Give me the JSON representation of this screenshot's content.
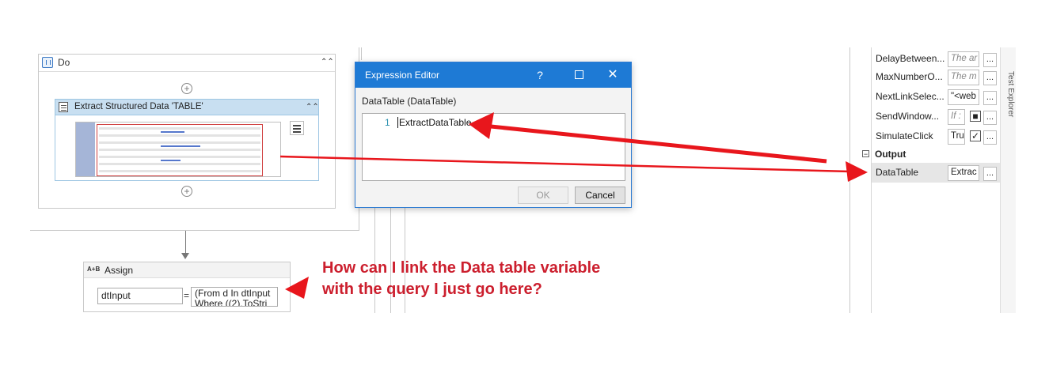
{
  "designer": {
    "do_label": "Do",
    "extract_title": "Extract Structured Data 'TABLE'",
    "assign": {
      "label": "Assign",
      "icon_text": "A+B",
      "to_value": "dtInput",
      "equals": "=",
      "value_text": "(From d In dtInput\nWhere ((2).ToStri"
    }
  },
  "dialog": {
    "title": "Expression Editor",
    "help": "?",
    "close": "✕",
    "type_label": "DataTable (DataTable)",
    "line_number": "1",
    "code": "ExtractDataTable",
    "ok_label": "OK",
    "cancel_label": "Cancel"
  },
  "properties": {
    "rows": [
      {
        "name": "DelayBetween...",
        "value": "The ar",
        "hint": true
      },
      {
        "name": "MaxNumberO...",
        "value": "The m",
        "hint": true
      },
      {
        "name": "NextLinkSelec...",
        "value": "\"<web",
        "hint": false
      },
      {
        "name": "SendWindow...",
        "value": "If :",
        "hint": true
      },
      {
        "name": "SimulateClick",
        "value": "Tru",
        "hint": false
      }
    ],
    "output_category": "Output",
    "output_row": {
      "name": "DataTable",
      "value": "Extrac"
    },
    "dots": "..."
  },
  "side_strip": "Test Explorer",
  "annotation": {
    "question": "How can I link the Data table variable with the query I just go here?",
    "arrow_color": "#e8161c"
  }
}
